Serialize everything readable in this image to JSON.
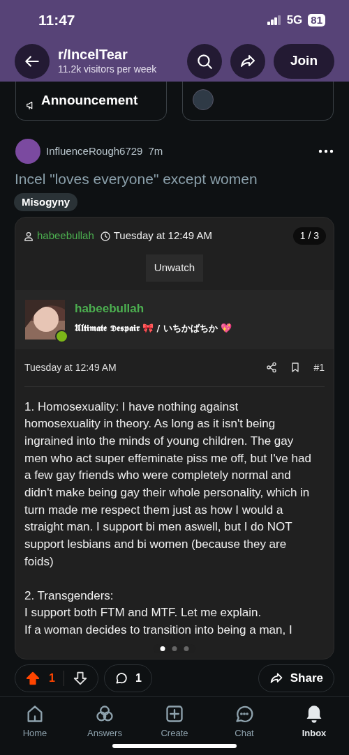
{
  "status_bar": {
    "time": "11:47",
    "network": "5G",
    "battery": "81"
  },
  "header": {
    "title": "r/IncelTear",
    "subtitle": "11.2k visitors per week",
    "join": "Join"
  },
  "pinned_cards": [
    {
      "kind": "label",
      "label": "Announcement"
    },
    {
      "kind": "avatar"
    }
  ],
  "post": {
    "author": "InfluenceRough6729",
    "age": "7m",
    "title": "Incel \"loves everyone\" except women",
    "flair": "Misogyny",
    "image": {
      "user": "habeebullah",
      "date": "Tuesday at 12:49 AM",
      "counter": "1 / 3",
      "watch_button": "Unwatch",
      "profile_name": "habeebullah",
      "profile_tagline": "𝖀𝖑𝖙𝖎𝖒𝖆𝖙𝖊 𝕯𝖊𝖘𝖕𝖆𝖎𝖗 🎀 / いちかばちか 💖",
      "post_date": "Tuesday at 12:49 AM",
      "post_number": "#1",
      "paragraphs": [
        "1. Homosexuality: I have nothing against homosexuality in theory. As long as it isn't being ingrained into the minds of young children. The gay men who act super effeminate piss me off, but I've had a few gay friends who were completely normal and didn't make being gay their whole personality, which in turn made me respect them just as how I would a straight man. I support bi men aswell, but I do NOT support lesbians and bi women (because they are foids)",
        "2. Transgenders:\nI support both FTM and MTF. Let me explain.\nIf a woman decides to transition into being a man, I"
      ]
    },
    "slides": [
      {
        "selected": true
      },
      {
        "selected": false
      },
      {
        "selected": false
      }
    ],
    "votes": {
      "count": "1",
      "upvoted": true
    },
    "comments": "1",
    "share": "Share"
  },
  "nav": [
    {
      "label": "Home",
      "selected": false
    },
    {
      "label": "Answers",
      "selected": false
    },
    {
      "label": "Create",
      "selected": false
    },
    {
      "label": "Chat",
      "selected": false
    },
    {
      "label": "Inbox",
      "selected": true
    }
  ]
}
